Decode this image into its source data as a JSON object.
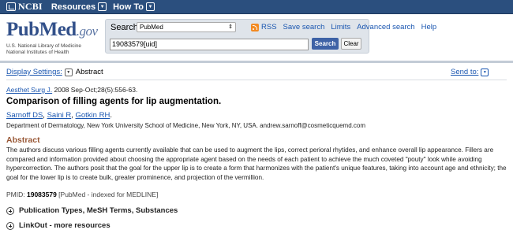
{
  "topbar": {
    "brand": "NCBI",
    "menus": [
      {
        "label": "Resources"
      },
      {
        "label": "How To"
      }
    ]
  },
  "header": {
    "logo": {
      "pub": "Pub",
      "med": "Med",
      "gov": ".gov",
      "line1": "U.S. National Library of Medicine",
      "line2": "National Institutes of Health"
    },
    "search_label": "Search:",
    "database": "PubMed",
    "query": "19083579[uid]",
    "search_button": "Search",
    "clear_button": "Clear",
    "links": [
      "RSS",
      "Save search",
      "Limits",
      "Advanced search",
      "Help"
    ]
  },
  "toolbar": {
    "display_settings": "Display Settings:",
    "display_value": "Abstract",
    "send_to": "Send to:"
  },
  "article": {
    "journal": "Aesthet Surg J.",
    "citation_rest": " 2008 Sep-Oct;28(5):556-63.",
    "title": "Comparison of filling agents for lip augmentation.",
    "authors": [
      "Sarnoff DS",
      "Saini R",
      "Gotkin RH"
    ],
    "affiliation": "Department of Dermatology, New York University School of Medicine, New York, NY, USA. andrew.sarnoff@cosmeticquemd.com",
    "abstract_heading": "Abstract",
    "abstract_text": "The authors discuss various filling agents currently available that can be used to augment the lips, correct perioral rhytides, and enhance overall lip appearance. Fillers are compared and information provided about choosing the appropriate agent based on the needs of each patient to achieve the much coveted \"pouty\" look while avoiding hypercorrection. The authors posit that the goal for the upper lip is to create a form that harmonizes with the patient's unique features, taking into account age and ethnicity; the goal for the lower lip is to create bulk, greater prominence, and projection of the vermillion.",
    "pmid_label": "PMID: ",
    "pmid": "19083579",
    "pmid_note": " [PubMed - indexed for MEDLINE]"
  },
  "sections": [
    {
      "label": "Publication Types, MeSH Terms, Substances"
    },
    {
      "label": "LinkOut - more resources"
    }
  ],
  "colors": {
    "topbar": "#2b4f7e",
    "link": "#1a56b0",
    "abstract_heading": "#985735",
    "search_button": "#3e62a6"
  }
}
